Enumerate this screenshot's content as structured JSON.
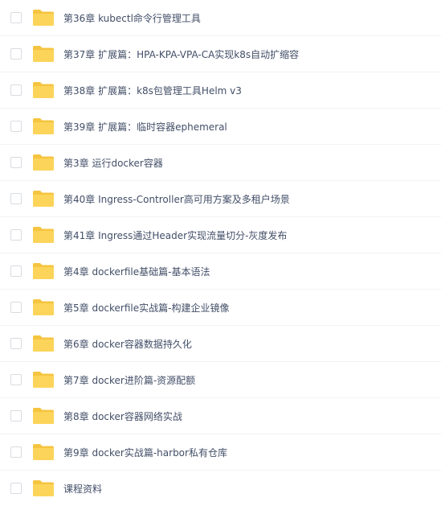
{
  "file_list": {
    "items": [
      {
        "label": "第36章 kubectl命令行管理工具"
      },
      {
        "label": "第37章 扩展篇：HPA-KPA-VPA-CA实现k8s自动扩缩容"
      },
      {
        "label": "第38章 扩展篇：k8s包管理工具Helm v3"
      },
      {
        "label": "第39章 扩展篇：临时容器ephemeral"
      },
      {
        "label": "第3章 运行docker容器"
      },
      {
        "label": "第40章 Ingress-Controller高可用方案及多租户场景"
      },
      {
        "label": "第41章 Ingress通过Header实现流量切分-灰度发布"
      },
      {
        "label": "第4章 dockerfile基础篇-基本语法"
      },
      {
        "label": "第5章 dockerfile实战篇-构建企业镜像"
      },
      {
        "label": "第6章 docker容器数据持久化"
      },
      {
        "label": "第7章 docker进阶篇-资源配额"
      },
      {
        "label": "第8章 docker容器网络实战"
      },
      {
        "label": "第9章 docker实战篇-harbor私有仓库"
      },
      {
        "label": "课程资料"
      }
    ],
    "colors": {
      "folder_back": "#f5c440",
      "folder_front": "#fcd45a",
      "text": "#424e67",
      "checkbox_border": "#d8dbe0",
      "divider": "#f1f2f4"
    }
  }
}
